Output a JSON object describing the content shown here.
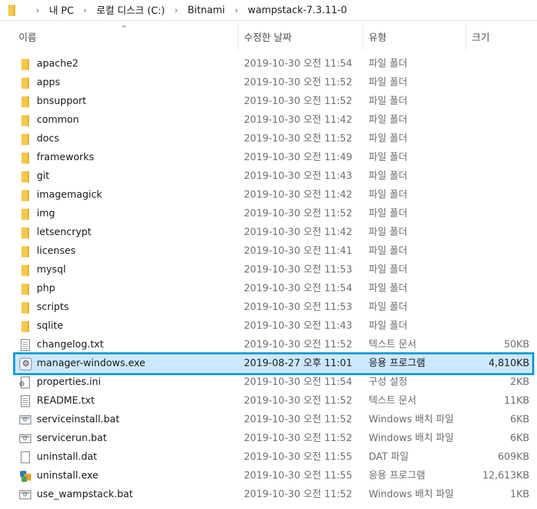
{
  "breadcrumb": [
    "내 PC",
    "로컬 디스크 (C:)",
    "Bitnami",
    "wampstack-7.3.11-0"
  ],
  "columns": {
    "name": "이름",
    "date": "수정한 날짜",
    "type": "유형",
    "size": "크기"
  },
  "files": [
    {
      "name": "apache2",
      "date": "2019-10-30 오전 11:54",
      "type": "파일 폴더",
      "size": "",
      "icon": "folder-icon"
    },
    {
      "name": "apps",
      "date": "2019-10-30 오전 11:52",
      "type": "파일 폴더",
      "size": "",
      "icon": "folder-icon"
    },
    {
      "name": "bnsupport",
      "date": "2019-10-30 오전 11:52",
      "type": "파일 폴더",
      "size": "",
      "icon": "folder-icon"
    },
    {
      "name": "common",
      "date": "2019-10-30 오전 11:42",
      "type": "파일 폴더",
      "size": "",
      "icon": "folder-icon"
    },
    {
      "name": "docs",
      "date": "2019-10-30 오전 11:52",
      "type": "파일 폴더",
      "size": "",
      "icon": "folder-icon"
    },
    {
      "name": "frameworks",
      "date": "2019-10-30 오전 11:49",
      "type": "파일 폴더",
      "size": "",
      "icon": "folder-icon"
    },
    {
      "name": "git",
      "date": "2019-10-30 오전 11:43",
      "type": "파일 폴더",
      "size": "",
      "icon": "folder-icon"
    },
    {
      "name": "imagemagick",
      "date": "2019-10-30 오전 11:42",
      "type": "파일 폴더",
      "size": "",
      "icon": "folder-icon"
    },
    {
      "name": "img",
      "date": "2019-10-30 오전 11:52",
      "type": "파일 폴더",
      "size": "",
      "icon": "folder-icon"
    },
    {
      "name": "letsencrypt",
      "date": "2019-10-30 오전 11:42",
      "type": "파일 폴더",
      "size": "",
      "icon": "folder-icon"
    },
    {
      "name": "licenses",
      "date": "2019-10-30 오전 11:41",
      "type": "파일 폴더",
      "size": "",
      "icon": "folder-icon"
    },
    {
      "name": "mysql",
      "date": "2019-10-30 오전 11:53",
      "type": "파일 폴더",
      "size": "",
      "icon": "folder-icon"
    },
    {
      "name": "php",
      "date": "2019-10-30 오전 11:54",
      "type": "파일 폴더",
      "size": "",
      "icon": "folder-icon"
    },
    {
      "name": "scripts",
      "date": "2019-10-30 오전 11:53",
      "type": "파일 폴더",
      "size": "",
      "icon": "folder-icon"
    },
    {
      "name": "sqlite",
      "date": "2019-10-30 오전 11:43",
      "type": "파일 폴더",
      "size": "",
      "icon": "folder-icon"
    },
    {
      "name": "changelog.txt",
      "date": "2019-10-30 오전 11:52",
      "type": "텍스트 문서",
      "size": "50KB",
      "icon": "text-file-icon"
    },
    {
      "name": "manager-windows.exe",
      "date": "2019-08-27 오후 11:01",
      "type": "응용 프로그램",
      "size": "4,810KB",
      "icon": "application-icon",
      "selected": true
    },
    {
      "name": "properties.ini",
      "date": "2019-10-30 오전 11:54",
      "type": "구성 설정",
      "size": "2KB",
      "icon": "settings-file-icon"
    },
    {
      "name": "README.txt",
      "date": "2019-10-30 오전 11:52",
      "type": "텍스트 문서",
      "size": "11KB",
      "icon": "text-file-icon"
    },
    {
      "name": "serviceinstall.bat",
      "date": "2019-10-30 오전 11:52",
      "type": "Windows 배치 파일",
      "size": "6KB",
      "icon": "batch-file-icon"
    },
    {
      "name": "servicerun.bat",
      "date": "2019-10-30 오전 11:52",
      "type": "Windows 배치 파일",
      "size": "6KB",
      "icon": "batch-file-icon"
    },
    {
      "name": "uninstall.dat",
      "date": "2019-10-30 오전 11:55",
      "type": "DAT 파일",
      "size": "609KB",
      "icon": "blank-file-icon"
    },
    {
      "name": "uninstall.exe",
      "date": "2019-10-30 오전 11:55",
      "type": "응용 프로그램",
      "size": "12,613KB",
      "icon": "installer-icon"
    },
    {
      "name": "use_wampstack.bat",
      "date": "2019-10-30 오전 11:52",
      "type": "Windows 배치 파일",
      "size": "1KB",
      "icon": "batch-file-icon"
    }
  ],
  "colors": {
    "selection_bg": "#cce8ff",
    "selection_border": "#0c9ad7",
    "folder": "#f5c84a"
  }
}
